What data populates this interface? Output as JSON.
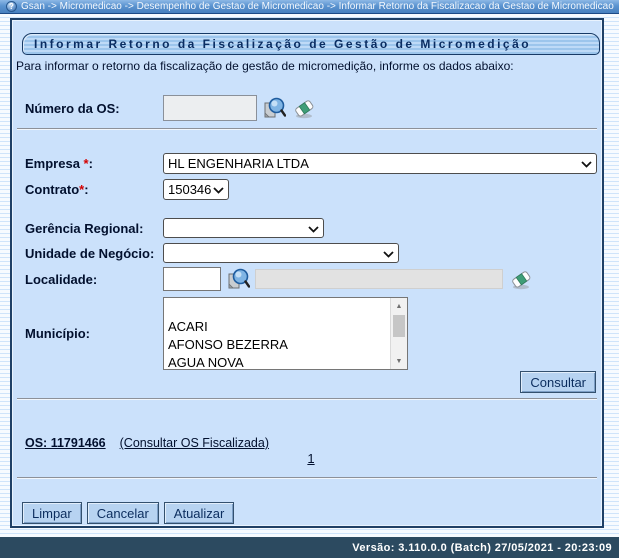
{
  "breadcrumb": {
    "text": "Gsan -> Micromedicao -> Desempenho de Gestao de Micromedicao -> Informar Retorno da Fiscalizacao da Gestao de Micromedicao",
    "help_glyph": "?"
  },
  "panel": {
    "title": "Informar Retorno da Fiscalização de Gestão de Micromedição",
    "description": "Para informar o retorno da fiscalização de gestão de micromedição, informe os dados abaixo:"
  },
  "form": {
    "numero_os": {
      "label": "Número da OS:",
      "value": ""
    },
    "empresa": {
      "label": "Empresa",
      "star": " *",
      "colon": ":",
      "value": "HL ENGENHARIA LTDA"
    },
    "contrato": {
      "label": "Contrato",
      "star": "*",
      "colon": ":",
      "value": "150346"
    },
    "gerencia": {
      "label": "Gerência Regional:",
      "value": ""
    },
    "unidade": {
      "label": "Unidade de Negócio:",
      "value": ""
    },
    "localidade": {
      "label": "Localidade:",
      "value": "",
      "nome_value": ""
    },
    "municipio": {
      "label": "Município:",
      "options": [
        "",
        "ACARI",
        "AFONSO BEZERRA",
        "AGUA NOVA"
      ]
    },
    "consultar_label": "Consultar"
  },
  "result": {
    "os_link": "OS: 11791466",
    "consultar_os_link": "(Consultar OS Fiscalizada)",
    "page_number": "1"
  },
  "actions": {
    "limpar": "Limpar",
    "cancelar": "Cancelar",
    "atualizar": "Atualizar"
  },
  "footer": {
    "version_text": "Versão: 3.110.0.0 (Batch) 27/05/2021 - 20:23:09"
  },
  "icons": {
    "search_icon": "magnifier-with-document",
    "eraser_icon": "eraser",
    "scroll_up_glyph": "▲",
    "scroll_down_glyph": "▼"
  },
  "colors": {
    "topbar_blue": "#5b94d0",
    "panel_bg": "#cbe1fb",
    "panel_border": "#1f4066",
    "title_text": "#0a2d62",
    "required_red": "#d40000",
    "footer_bg": "#2c4a60"
  }
}
